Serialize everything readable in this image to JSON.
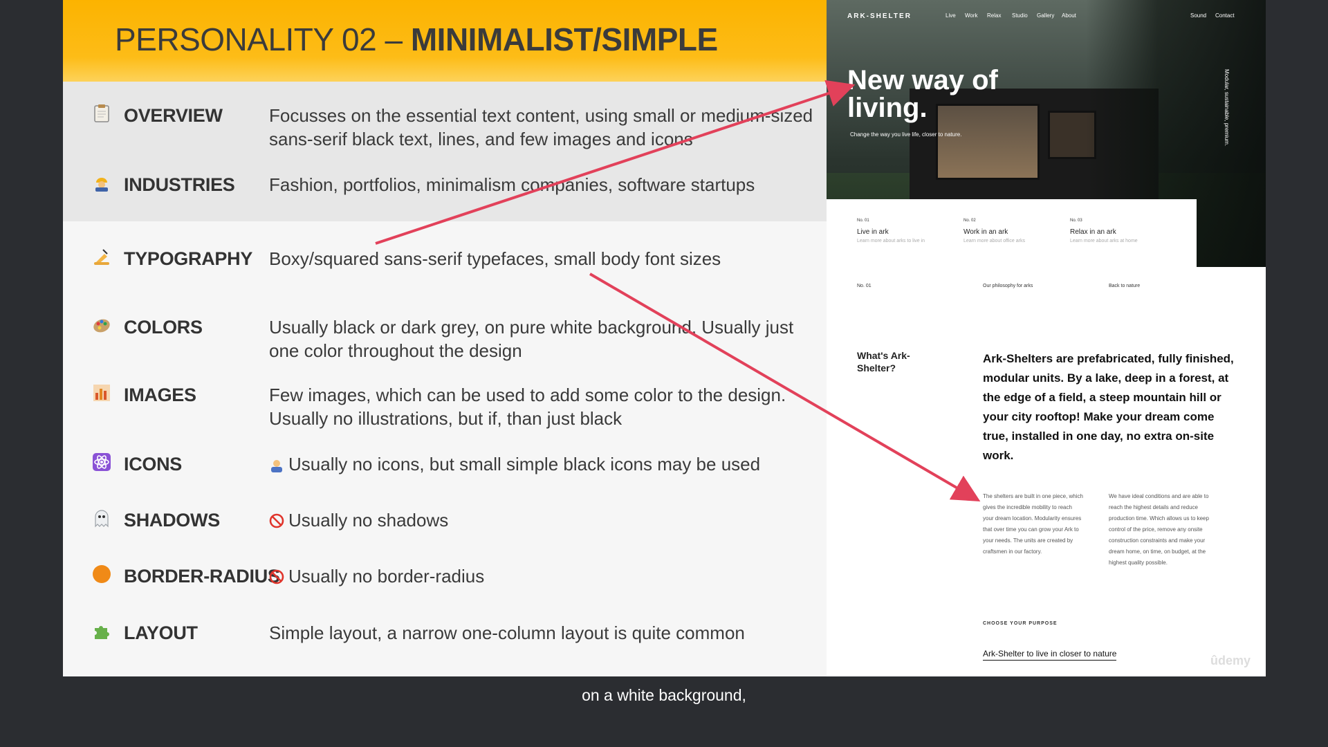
{
  "slide": {
    "title_light": "PERSONALITY 02 – ",
    "title_bold": "MINIMALIST/SIMPLE",
    "colors": {
      "header": "#fcb300",
      "arrow": "#e2415a",
      "gray_band": "#e7e7e7"
    },
    "rows": [
      {
        "icon": "clipboard-icon",
        "label": "OVERVIEW",
        "desc": "Focusses on the essential text content, using small or medium-sized sans-serif black text, lines, and few images and icons"
      },
      {
        "icon": "factory-worker-icon",
        "label": "INDUSTRIES",
        "desc": "Fashion, portfolios, minimalism companies, software startups"
      },
      {
        "icon": "writing-hand-icon",
        "label": "TYPOGRAPHY",
        "desc": "Boxy/squared sans-serif typefaces, small body font sizes"
      },
      {
        "icon": "palette-icon",
        "label": "COLORS",
        "desc": "Usually black or dark grey, on pure white background. Usually just one color throughout the design"
      },
      {
        "icon": "bar-chart-icon",
        "label": "IMAGES",
        "desc": "Few images, which can be used to add some color to the design. Usually no illustrations, but if, than just black"
      },
      {
        "icon": "atom-icon",
        "label": "ICONS",
        "pre_icon": "shrug-icon",
        "desc": "Usually no icons, but small simple black icons may be used"
      },
      {
        "icon": "ghost-icon",
        "label": "SHADOWS",
        "pre_icon": "no-entry-icon",
        "desc": "Usually no shadows"
      },
      {
        "icon": "orange-circle-icon",
        "label": "BORDER-RADIUS",
        "pre_icon": "no-entry-icon",
        "desc": "Usually no border-radius"
      },
      {
        "icon": "puzzle-icon",
        "label": "LAYOUT",
        "desc": "Simple layout, a narrow one-column layout is quite common"
      }
    ]
  },
  "screenshot": {
    "logo": "ARK-SHELTER",
    "nav": [
      "Live",
      "Work",
      "Relax",
      "Studio",
      "Gallery",
      "About"
    ],
    "nav_right": [
      "Sound",
      "Contact"
    ],
    "hero_title": "New way of living.",
    "hero_sub": "Change the way you live life, closer to nature.",
    "side_text": "Modular, sustainable, premium.",
    "cards": [
      {
        "no": "No. 01",
        "title": "Live in ark",
        "sub": "Learn more about arks to live in"
      },
      {
        "no": "No. 02",
        "title": "Work in an ark",
        "sub": "Learn more about office arks"
      },
      {
        "no": "No. 03",
        "title": "Relax in an ark",
        "sub": "Learn more about arks at home"
      }
    ],
    "labels": [
      "No. 01",
      "Our philosophy for arks",
      "Back to nature"
    ],
    "what": "What's Ark-Shelter?",
    "body": "Ark-Shelters are prefabricated, fully finished, modular units. By a lake, deep in a forest, at the edge of a field, a steep mountain hill or your city rooftop! Make your dream come true, installed in one day, no extra on-site work.",
    "col1": "The shelters are built in one piece, which gives the incredible mobility to reach your dream location. Modularity ensures that over time you can grow your Ark to your needs. The units are created by craftsmen in our factory.",
    "col2": "We have ideal conditions and are able to reach the highest details and reduce production time. Which allows us to keep control of the price, remove any onsite construction constraints and make your dream home, on time, on budget, at the highest quality possible.",
    "purpose": "CHOOSE YOUR PURPOSE",
    "link": "Ark-Shelter to live in closer to nature",
    "watermark": "ûdemy"
  },
  "caption": "on a white background,"
}
